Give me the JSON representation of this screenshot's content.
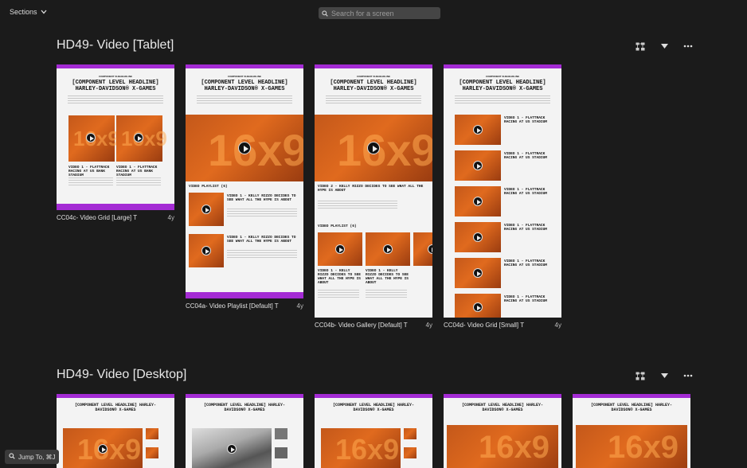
{
  "topbar": {
    "sections_label": "Sections",
    "search_placeholder": "Search for a screen"
  },
  "sections": [
    {
      "title": "HD49- Video [Tablet]",
      "cards": [
        {
          "label": "CC04c- Video Grid [Large] T",
          "age": "4y"
        },
        {
          "label": "CC04a- Video Playlist [Default] T",
          "age": "4y"
        },
        {
          "label": "CC04b- Video Gallery [Default] T",
          "age": "4y"
        },
        {
          "label": "CC04d- Video Grid [Small] T",
          "age": "4y"
        }
      ]
    },
    {
      "title": "HD49- Video [Desktop]"
    }
  ],
  "thumb": {
    "subheadline": "COMPONENT SUBHEADLINE",
    "headline": "[COMPONENT LEVEL HEADLINE] HARLEY-DAVIDSON® X-GAMES",
    "video1_small": "VIDEO 1 - FLATTRACK RACING AT US BANK STADIUM",
    "video_kelly": "VIDEO 1 - KELLY RIZZO DECIDES TO SEE WHAT ALL THE HYPE IS ABOUT",
    "video2_kelly": "VIDEO 2 - KELLY RIZZO DECIDES TO SEE WHAT ALL THE HYPE IS ABOUT",
    "playlist": "VIDEO PLAYLIST (6)",
    "video_flattrack": "VIDEO 1 - FLATTRACK RACING AT US STADIUM",
    "bg_number": "16x9"
  },
  "jump": {
    "label": "Jump To, ⌘J"
  }
}
